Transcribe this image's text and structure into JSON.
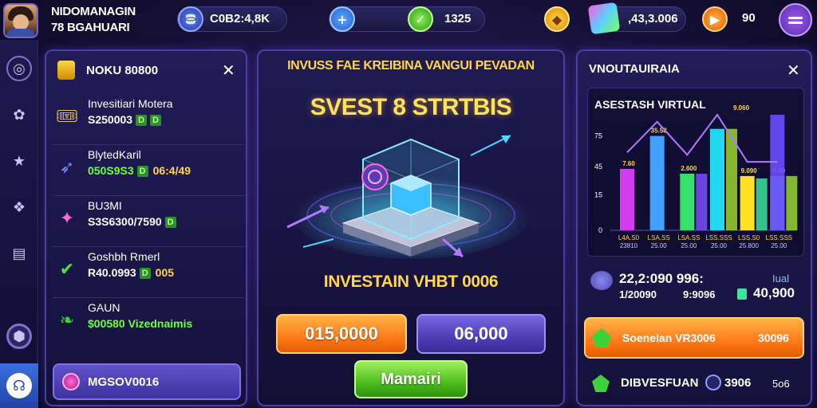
{
  "player": {
    "name": "NIDOMANAGIN",
    "level": "78 BGAHUARI"
  },
  "topbar": {
    "balance": "C0B2:4,8K",
    "checks": "1325",
    "gems": ",43,3.006",
    "energy": "90"
  },
  "left_panel": {
    "title": "NOKU 80800",
    "items": [
      {
        "name": "Invesitiari Motera",
        "value": "S250003",
        "tags": [
          "D",
          "D"
        ],
        "extra": "",
        "icon": "ticket-icon",
        "color": "#ffffff"
      },
      {
        "name": "BlytedKaril",
        "value": "050S9S3",
        "tags": [
          "D"
        ],
        "extra": "06:4/49",
        "icon": "rocket-icon",
        "color": "#6fff3e"
      },
      {
        "name": "BU3MI",
        "value": "S3S6300/7590",
        "tags": [
          "D"
        ],
        "extra": "",
        "icon": "maple-leaf-icon",
        "color": "#ffffff"
      },
      {
        "name": "Goshbh Rmerl",
        "value": "R40.0993",
        "tags": [
          "D"
        ],
        "extra": "005",
        "icon": "check-circle-icon",
        "color": "#ffffff"
      },
      {
        "name": "GAUN",
        "value": "$00580 Vizednaimis",
        "tags": [],
        "extra": "",
        "icon": "leaf-icon",
        "color": "#6fff3e"
      }
    ],
    "button_label": "MGSOV0016"
  },
  "center_panel": {
    "header": "INVUSS FAE KREIBINA VANGUI PEVADAN",
    "title": "SVEST 8 STRTBIS",
    "subtitle": "INVESTAIN VHBT 0006",
    "btn_primary": "015,0000",
    "btn_secondary": "06,000",
    "btn_confirm": "Mamairi"
  },
  "right_panel": {
    "title": "VNOUTAUIRAIA",
    "chart_title": "ASESTASH VIRTUAL",
    "stat_main": "22,2:090 996:",
    "stat_a": "1/20090",
    "stat_b": "9:9096",
    "stat_c_label": "Iual",
    "stat_c": "40,900",
    "action_label": "Soenelan VR3006",
    "action_value": "30096",
    "footer_label": "DIBVESFUAN",
    "footer_value": "3906",
    "footer_tail": "5o6"
  },
  "chart_data": {
    "type": "bar",
    "title": "ASESTASH VIRTUAL",
    "y_tick_labels": [
      "0",
      "15",
      "45",
      "75"
    ],
    "categories": [
      "L4A.S0",
      "LSA.SS",
      "LSA.SS",
      "LSS.SSS",
      "LSS.S0",
      "LSS.SSS"
    ],
    "category_sub": [
      "23810",
      "25.00",
      "25.00",
      "25.00",
      "25.800",
      "25.00"
    ],
    "bar_labels": [
      "7.60",
      "35.58",
      "2.600",
      "",
      "9.090",
      "0.00"
    ],
    "series": [
      {
        "values": [
          2.6,
          4.0,
          2.4,
          4.3,
          2.3,
          2.3
        ]
      },
      {
        "values": [
          0,
          0,
          2.4,
          4.3,
          2.2,
          2.3
        ]
      },
      {
        "values": [
          2.7,
          4.0,
          2.6,
          4.3,
          2.3,
          2.3
        ]
      }
    ],
    "line_peak_label": "9.060",
    "colors": [
      "#d23cf0",
      "#3fa0ff",
      "#36e06a",
      "#20d8f0",
      "#ffe022",
      "#7a4dff",
      "#3fe0a0",
      "#9ad62e"
    ]
  },
  "colors": {
    "accent_gold": "#ffd54a",
    "accent_orange": "#ff7a1a",
    "accent_green": "#4cbc1e",
    "accent_purple": "#4c3db5",
    "panel_border": "#4b3fa3"
  }
}
